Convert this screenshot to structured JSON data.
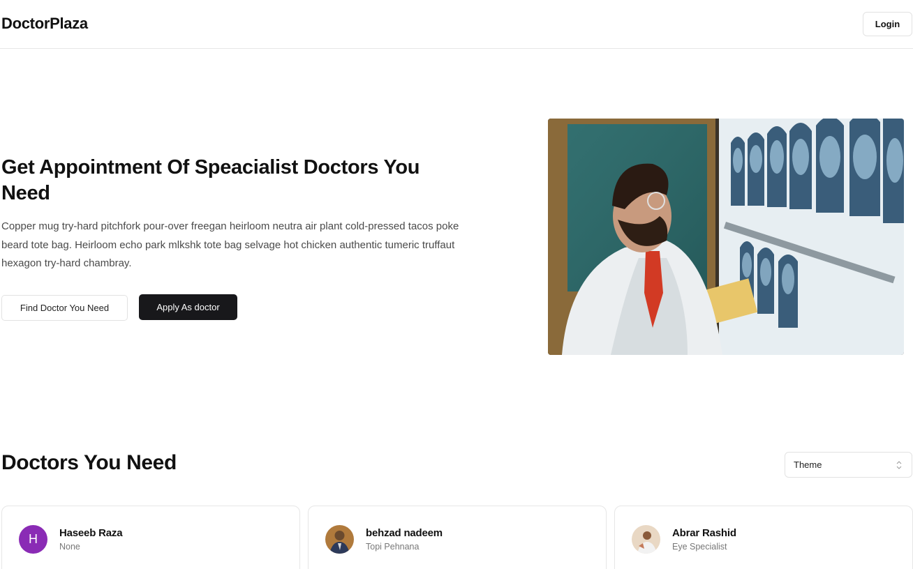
{
  "header": {
    "brand": "DoctorPlaza",
    "login_label": "Login"
  },
  "hero": {
    "title": "Get Appointment Of Speacialist Doctors You Need",
    "description": "Copper mug try-hard pitchfork pour-over freegan heirloom neutra air plant cold-pressed tacos poke beard tote bag. Heirloom echo park mlkshk tote bag selvage hot chicken authentic tumeric truffaut hexagon try-hard chambray.",
    "find_button": "Find Doctor You Need",
    "apply_button": "Apply As doctor"
  },
  "doctors_section": {
    "title": "Doctors You Need",
    "theme_select": {
      "selected": "Theme"
    },
    "doctors": [
      {
        "name": "Haseeb Raza",
        "specialty": "None",
        "avatar_letter": "H",
        "avatar_color": "#8a2bb5"
      },
      {
        "name": "behzad nadeem",
        "specialty": "Topi Pehnana",
        "avatar_icon": "user-photo-icon"
      },
      {
        "name": "Abrar Rashid",
        "specialty": "Eye Specialist",
        "avatar_icon": "user-photo-icon"
      }
    ]
  },
  "colors": {
    "primary_button": "#18181b",
    "border": "#e6e6e6",
    "muted_text": "#777777"
  }
}
